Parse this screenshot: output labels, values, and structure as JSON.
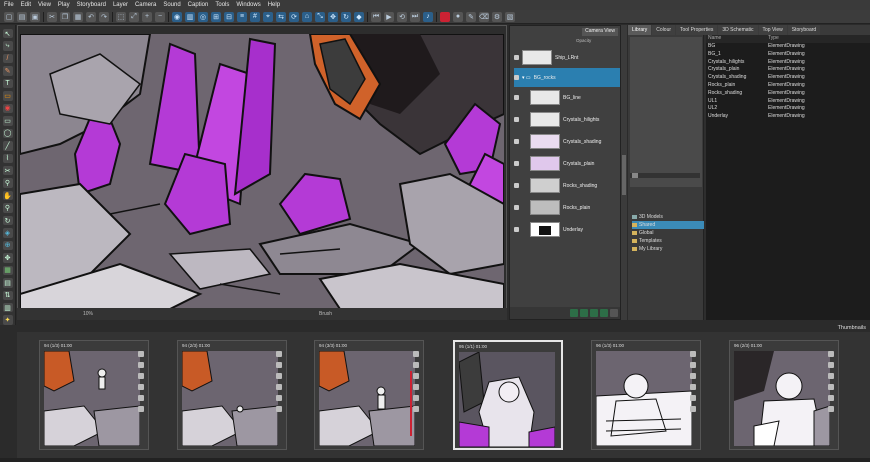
{
  "menu": [
    "File",
    "Edit",
    "View",
    "Play",
    "Storyboard",
    "Layer",
    "Camera",
    "Sound",
    "Caption",
    "Tools",
    "Windows",
    "Help"
  ],
  "camera_view_tab": "Camera View",
  "opacity_label": "Opacity",
  "layers": [
    {
      "name": "Ship_LRnt",
      "selected": false
    },
    {
      "name": "BG_rocks",
      "selected": true
    },
    {
      "name": "BG_line",
      "selected": false
    },
    {
      "name": "Crystals_hilights",
      "selected": false
    },
    {
      "name": "Crystals_shading",
      "selected": false
    },
    {
      "name": "Crystals_plain",
      "selected": false
    },
    {
      "name": "Rocks_shading",
      "selected": false
    },
    {
      "name": "Rocks_plain",
      "selected": false
    },
    {
      "name": "Underlay",
      "selected": false
    }
  ],
  "canvas_status": {
    "zoom": "10%",
    "tool": "Brush"
  },
  "right_tabs": [
    "Library",
    "Colour",
    "Tool Properties",
    "3D Schematic",
    "Top View",
    "Storyboard"
  ],
  "library_tree": [
    {
      "name": "3D Models",
      "selected": false
    },
    {
      "name": "Shared",
      "selected": true
    },
    {
      "name": "Global",
      "selected": false
    },
    {
      "name": "Templates",
      "selected": false
    },
    {
      "name": "My Library",
      "selected": false
    }
  ],
  "library_table": {
    "columns": [
      "Name",
      "Type"
    ],
    "rows": [
      [
        "BG",
        "ElementDrawing"
      ],
      [
        "BG_1",
        "ElementDrawing"
      ],
      [
        "Crystals_hilights",
        "ElementDrawing"
      ],
      [
        "Crystals_plain",
        "ElementDrawing"
      ],
      [
        "Crystals_shading",
        "ElementDrawing"
      ],
      [
        "Rocks_plain",
        "ElementDrawing"
      ],
      [
        "Rocks_shading",
        "ElementDrawing"
      ],
      [
        "UL1",
        "ElementDrawing"
      ],
      [
        "UL2",
        "ElementDrawing"
      ],
      [
        "Underlay",
        "ElementDrawing"
      ]
    ]
  },
  "thumbnails_title": "Thumbnails",
  "thumbnails": [
    {
      "label": "94 (1/3) 01:00",
      "selected": false
    },
    {
      "label": "94 (2/3) 01:00",
      "selected": false
    },
    {
      "label": "94 (3/3) 01:00",
      "selected": false
    },
    {
      "label": "95 (1/1) 01:00",
      "selected": true
    },
    {
      "label": "96 (1/3) 01:00",
      "selected": false
    },
    {
      "label": "96 (2/3) 01:00",
      "selected": false
    }
  ],
  "colors": {
    "selection": "#2b7fb0",
    "crystal": "#b43ad6",
    "rock": "#6f6670"
  }
}
